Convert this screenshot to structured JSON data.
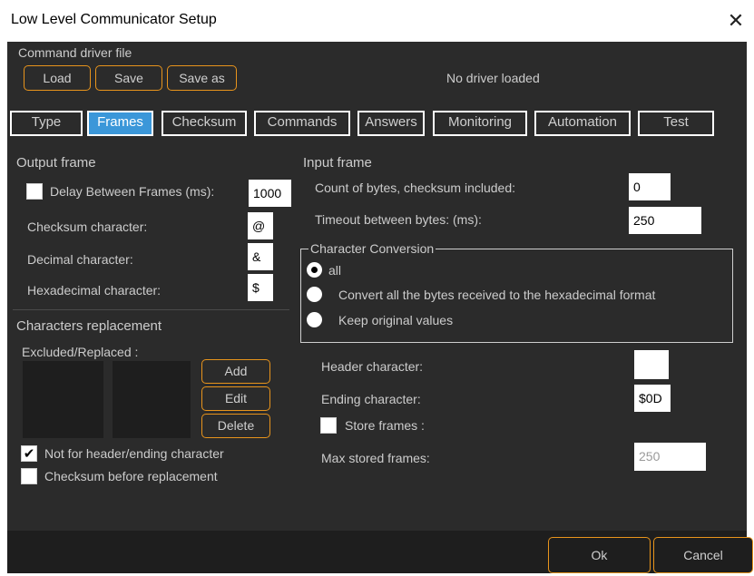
{
  "window": {
    "title": "Low Level Communicator Setup",
    "close": "✕"
  },
  "driver": {
    "section_label": "Command driver file",
    "load": "Load",
    "save": "Save",
    "save_as": "Save as",
    "status": "No driver loaded"
  },
  "tabs": [
    "Type",
    "Frames",
    "Checksum",
    "Commands",
    "Answers",
    "Monitoring",
    "Automation",
    "Test"
  ],
  "active_tab": "Frames",
  "output": {
    "title": "Output frame",
    "delay_label": "Delay Between Frames (ms):",
    "delay_checked": false,
    "delay_value": "1000",
    "checksum_label": "Checksum character:",
    "checksum_value": "@",
    "decimal_label": "Decimal character:",
    "decimal_value": "&",
    "hex_label": "Hexadecimal character:",
    "hex_value": "$"
  },
  "replacement": {
    "title": "Characters replacement",
    "excluded_label": "Excluded/Replaced :",
    "add": "Add",
    "edit": "Edit",
    "delete": "Delete",
    "not_for_header_label": "Not for header/ending character",
    "not_for_header_checked": true,
    "checksum_before_label": "Checksum before replacement",
    "checksum_before_checked": false
  },
  "input": {
    "title": "Input frame",
    "count_label": "Count of bytes, checksum included:",
    "count_value": "0",
    "timeout_label": "Timeout between bytes: (ms):",
    "timeout_value": "250",
    "conversion": {
      "title": "Character Conversion",
      "options": [
        "all",
        "Convert all the bytes received to the hexadecimal format",
        "Keep original values"
      ],
      "selected_index": 0
    },
    "header_label": "Header character:",
    "header_value": "",
    "ending_label": "Ending character:",
    "ending_value": "$0D",
    "store_label": "Store frames :",
    "store_checked": false,
    "max_label": "Max stored frames:",
    "max_value": "250"
  },
  "footer": {
    "ok": "Ok",
    "cancel": "Cancel"
  }
}
